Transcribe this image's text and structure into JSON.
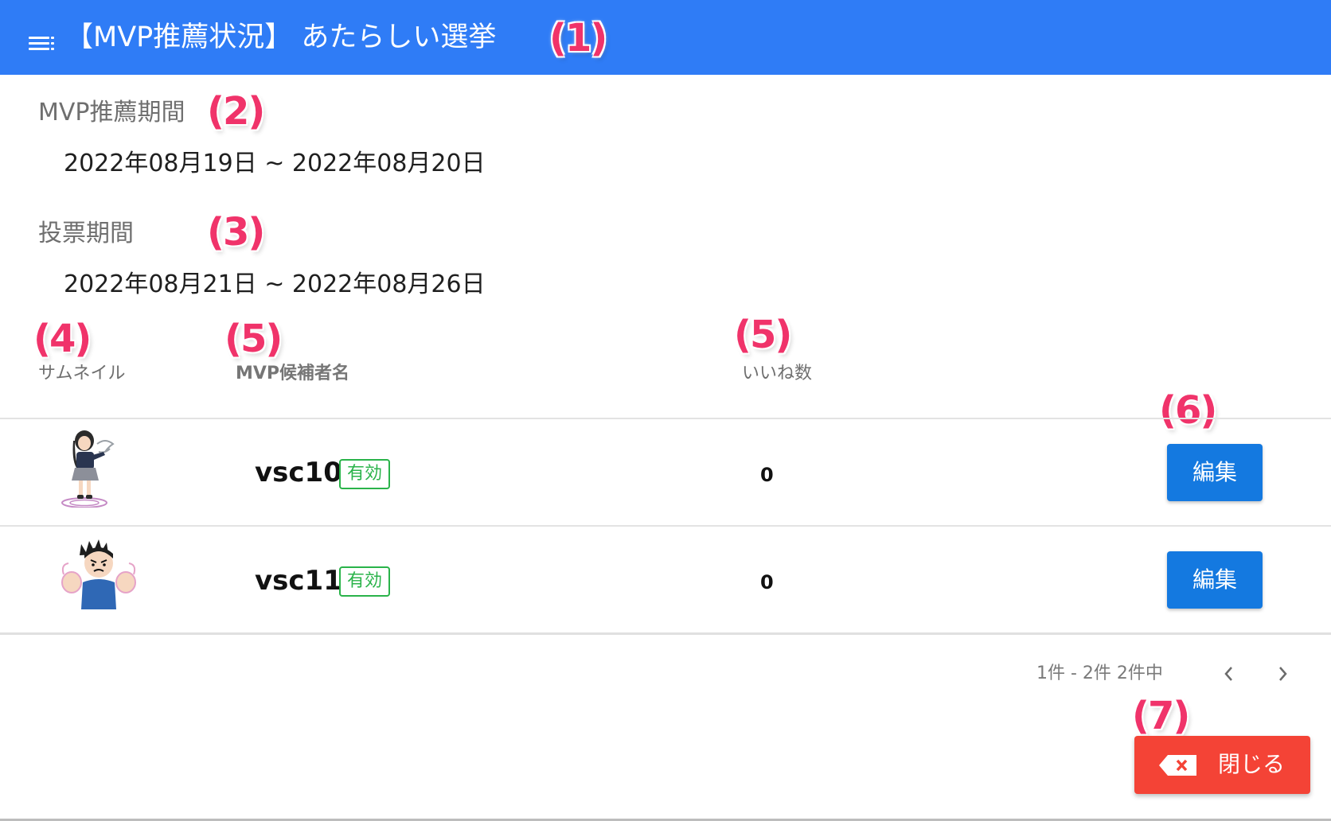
{
  "header": {
    "title": "【MVP推薦状況】 あたらしい選挙",
    "background": "#2f7cf6"
  },
  "annotations": {
    "m1": "(1)",
    "m2": "(2)",
    "m3": "(3)",
    "m4": "(4)",
    "m5a": "(5)",
    "m5b": "(5)",
    "m6": "(6)",
    "m7": "(7)"
  },
  "recommendation_period": {
    "label": "MVP推薦期間",
    "value": "2022年08月19日 ~ 2022年08月20日"
  },
  "voting_period": {
    "label": "投票期間",
    "value": "2022年08月21日 ~ 2022年08月26日"
  },
  "table": {
    "headers": {
      "thumbnail": "サムネイル",
      "candidate": "MVP候補者名",
      "likes": "いいね数"
    },
    "rows": [
      {
        "name": "vsc10",
        "status": "有効",
        "likes": "0",
        "action": "編集",
        "thumbnail_icon": "girl-character-icon"
      },
      {
        "name": "vsc11",
        "status": "有効",
        "likes": "0",
        "action": "編集",
        "thumbnail_icon": "boy-character-icon"
      }
    ]
  },
  "pagination": {
    "summary": "1件 - 2件 2件中",
    "prev_icon": "chevron-left-icon",
    "next_icon": "chevron-right-icon"
  },
  "close_button": {
    "label": "閉じる",
    "icon": "backspace-icon",
    "color": "#f44336"
  },
  "colors": {
    "accent": "#2f7cf6",
    "edit_button": "#1479e0",
    "badge": "#2ab34a",
    "marker": "#f0336a"
  }
}
